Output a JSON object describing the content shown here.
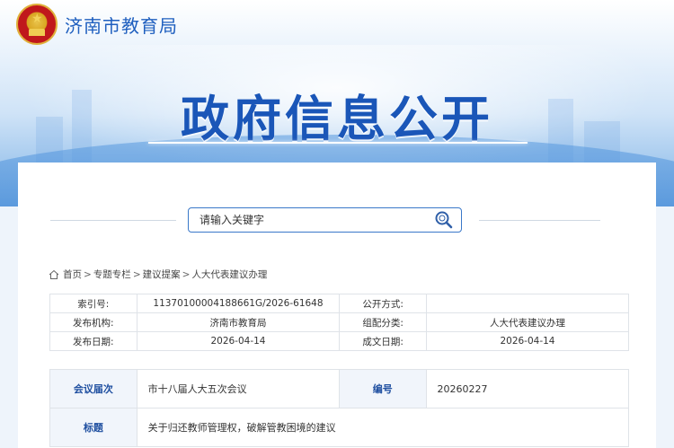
{
  "header": {
    "site_name": "济南市教育局",
    "emblem_icon": "national-emblem-icon",
    "banner_title": "政府信息公开"
  },
  "search": {
    "placeholder": "请输入关键字",
    "value": "",
    "button_icon": "search-icon"
  },
  "breadcrumb": {
    "home_icon": "home-icon",
    "items": [
      "首页",
      "专题专栏",
      "建议提案",
      "人大代表建议办理"
    ],
    "separator": ">"
  },
  "meta": {
    "rows": [
      {
        "label1": "索引号:",
        "value1": "11370100004188661G/2026-61648",
        "label2": "公开方式:",
        "value2": ""
      },
      {
        "label1": "发布机构:",
        "value1": "济南市教育局",
        "label2": "组配分类:",
        "value2": "人大代表建议办理"
      },
      {
        "label1": "发布日期:",
        "value1": "2026-04-14",
        "label2": "成文日期:",
        "value2": "2026-04-14"
      }
    ]
  },
  "detail": {
    "session_label": "会议届次",
    "session_value": "市十八届人大五次会议",
    "number_label": "编号",
    "number_value": "20260227",
    "title_label": "标题",
    "title_value": "关于归还教师管理权，破解管教困境的建议"
  },
  "colors": {
    "accent": "#1a56b8",
    "label_bg": "#f1f5fb",
    "border": "#dfe3e8"
  }
}
